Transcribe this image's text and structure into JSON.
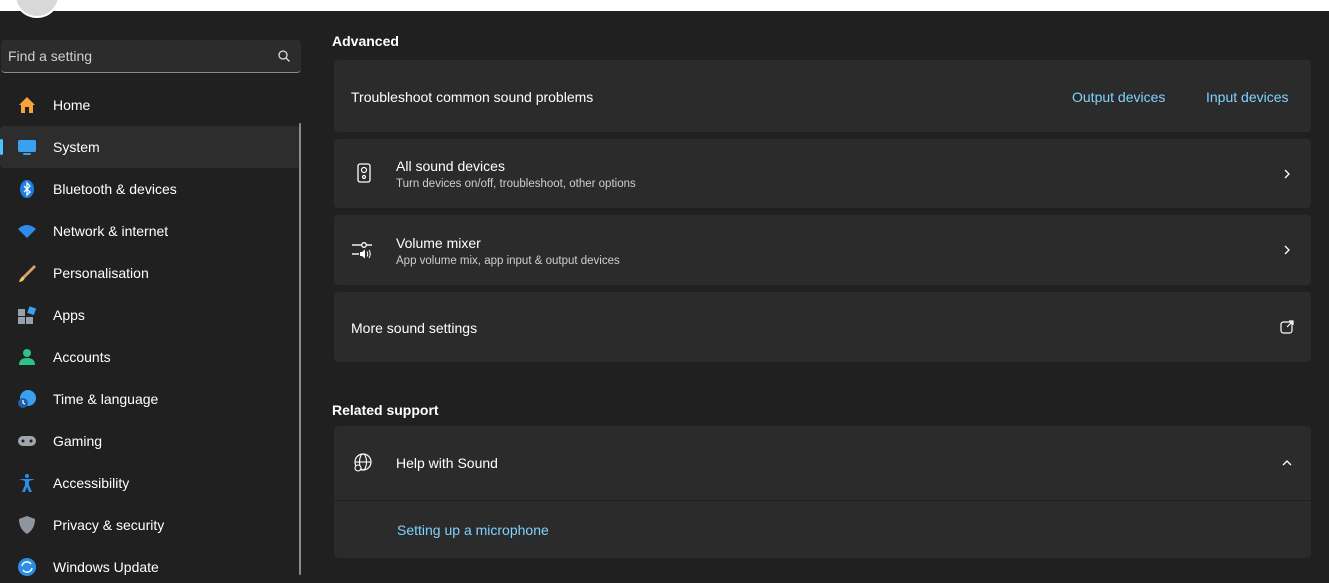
{
  "search": {
    "placeholder": "Find a setting"
  },
  "sidebar": {
    "items": [
      {
        "label": "Home",
        "icon": "home-icon"
      },
      {
        "label": "System",
        "icon": "system-icon",
        "active": true
      },
      {
        "label": "Bluetooth & devices",
        "icon": "bluetooth-icon"
      },
      {
        "label": "Network & internet",
        "icon": "wifi-icon"
      },
      {
        "label": "Personalisation",
        "icon": "brush-icon"
      },
      {
        "label": "Apps",
        "icon": "apps-icon"
      },
      {
        "label": "Accounts",
        "icon": "account-icon"
      },
      {
        "label": "Time & language",
        "icon": "globe-clock-icon"
      },
      {
        "label": "Gaming",
        "icon": "gamepad-icon"
      },
      {
        "label": "Accessibility",
        "icon": "accessibility-icon"
      },
      {
        "label": "Privacy & security",
        "icon": "shield-icon"
      },
      {
        "label": "Windows Update",
        "icon": "update-icon"
      }
    ]
  },
  "main": {
    "advanced_title": "Advanced",
    "troubleshoot": {
      "label": "Troubleshoot common sound problems",
      "output_link": "Output devices",
      "input_link": "Input devices"
    },
    "all_devices": {
      "title": "All sound devices",
      "subtitle": "Turn devices on/off, troubleshoot, other options"
    },
    "volume_mixer": {
      "title": "Volume mixer",
      "subtitle": "App volume mix, app input & output devices"
    },
    "more_sound": {
      "label": "More sound settings"
    },
    "related_title": "Related support",
    "help": {
      "title": "Help with Sound",
      "link": "Setting up a microphone"
    }
  },
  "colors": {
    "accent": "#4cc2ff",
    "link": "#7fd3ff",
    "background": "#202020",
    "card": "#2b2b2b"
  }
}
